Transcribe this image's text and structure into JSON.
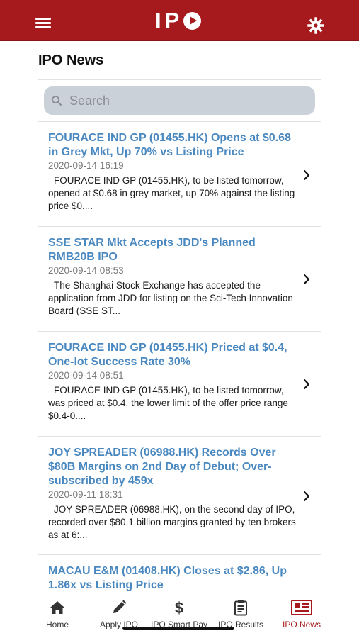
{
  "header": {
    "logo_text": "IP"
  },
  "page": {
    "title": "IPO News"
  },
  "search": {
    "placeholder": "Search"
  },
  "news": [
    {
      "title": "FOURACE IND GP (01455.HK) Opens at $0.68 in Grey Mkt, Up 70% vs Listing Price",
      "date": "2020-09-14 16:19",
      "summary": "FOURACE IND GP (01455.HK), to be listed tomorrow, opened at $0.68 in grey market, up 70% against the listing price $0...."
    },
    {
      "title": "SSE STAR Mkt Accepts JDD's Planned RMB20B IPO",
      "date": "2020-09-14 08:53",
      "summary": "The Shanghai Stock Exchange has accepted the application from JDD for listing on the Sci-Tech Innovation Board (SSE ST..."
    },
    {
      "title": "FOURACE IND GP (01455.HK) Priced at $0.4, One-lot Success Rate 30%",
      "date": "2020-09-14 08:51",
      "summary": "FOURACE IND GP (01455.HK), to be listed tomorrow, was priced at $0.4, the lower limit of the offer price range $0.4-0...."
    },
    {
      "title": "JOY SPREADER (06988.HK) Records Over $80B Margins on 2nd Day of Debut; Over-subscribed by 459x",
      "date": "2020-09-11 18:31",
      "summary": "JOY SPREADER (06988.HK), on the second day of IPO, recorded over $80.1 billion margins granted by ten brokers as at 6:..."
    },
    {
      "title": "MACAU E&M (01408.HK) Closes at $2.86, Up 1.86x vs Listing Price",
      "date": "",
      "summary": ""
    }
  ],
  "tabs": [
    {
      "label": "Home",
      "icon": "home-icon"
    },
    {
      "label": "Apply IPO",
      "icon": "pencil-icon"
    },
    {
      "label": "IPO Smart Pay",
      "icon": "dollar-icon"
    },
    {
      "label": "IPO Results",
      "icon": "clipboard-icon"
    },
    {
      "label": "IPO News",
      "icon": "newspaper-icon"
    }
  ],
  "colors": {
    "brand_red": "#a6191c",
    "headline_blue": "#4a88c0",
    "search_bg": "#cbd1d9",
    "date_gray": "#7a7a7a"
  }
}
